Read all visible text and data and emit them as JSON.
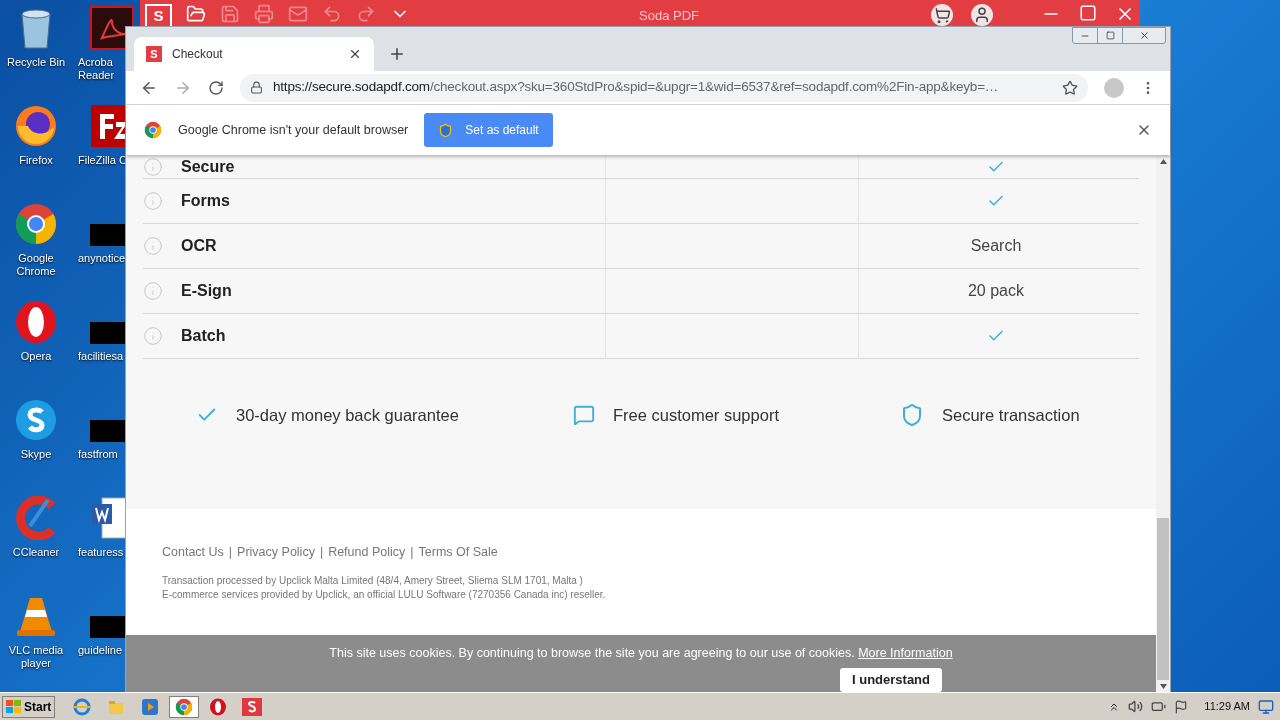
{
  "desktop": {
    "columns": [
      [
        {
          "kind": "recycle",
          "lines": [
            "Recycle Bin"
          ]
        },
        {
          "kind": "firefox",
          "lines": [
            "Firefox"
          ]
        },
        {
          "kind": "chrome",
          "lines": [
            "Google",
            "Chrome"
          ]
        },
        {
          "kind": "opera",
          "lines": [
            "Opera"
          ]
        },
        {
          "kind": "skype",
          "lines": [
            "Skype"
          ]
        },
        {
          "kind": "ccleaner",
          "lines": [
            "CCleaner"
          ]
        },
        {
          "kind": "vlc",
          "lines": [
            "VLC media",
            "player"
          ]
        }
      ],
      [
        {
          "kind": "acrobat",
          "lines": [
            "Acroba",
            "Reader"
          ]
        },
        {
          "kind": "filezilla",
          "lines": [
            "FileZilla C"
          ]
        },
        {
          "kind": "redacted",
          "lines": [
            "anynotice"
          ]
        },
        {
          "kind": "redacted",
          "lines": [
            "facilitiesa"
          ]
        },
        {
          "kind": "redacted",
          "lines": [
            "fastfrom"
          ]
        },
        {
          "kind": "word",
          "lines": [
            "featuress"
          ]
        },
        {
          "kind": "redacted",
          "lines": [
            "guideline"
          ]
        }
      ]
    ]
  },
  "soda_window": {
    "logo": "S",
    "title": "Soda PDF"
  },
  "browser": {
    "tabs": [
      {
        "title": "Checkout",
        "favicon": "S",
        "selected": true
      }
    ],
    "url_host": "https://secure.sodapdf.com",
    "url_path": "/checkout.aspx?sku=360StdPro&spid=&upgr=1&wid=6537&ref=sodapdf.com%2Fin-app&keyb=…",
    "infobar": {
      "message": "Google Chrome isn't your default browser",
      "button": "Set as default"
    }
  },
  "features": [
    {
      "name": "Secure",
      "kind": "check"
    },
    {
      "name": "Forms",
      "kind": "check"
    },
    {
      "name": "OCR",
      "kind": "text",
      "value": "Search"
    },
    {
      "name": "E-Sign",
      "kind": "text",
      "value": "20 pack"
    },
    {
      "name": "Batch",
      "kind": "check"
    }
  ],
  "guarantees": [
    {
      "kind": "check",
      "text": "30-day money back guarantee"
    },
    {
      "kind": "chat",
      "text": "Free customer support"
    },
    {
      "kind": "shield",
      "text": "Secure transaction"
    }
  ],
  "footer": {
    "links": [
      {
        "text": "Contact Us"
      },
      {
        "separator": "|",
        "text": "Privacy Policy"
      },
      {
        "separator": "|",
        "text": "Refund Policy"
      },
      {
        "separator": "|",
        "text": "Terms Of Sale"
      }
    ],
    "legal": [
      "Transaction processed by Upclick Malta Limited (48/4, Amery Street, Sliema SLM 1701, Malta )",
      "E-commerce services provided by Upclick, an official LULU Software (7270356 Canada inc) reseller."
    ]
  },
  "cookie_bar": {
    "text": "This site uses cookies. By continuing to browse the site you are agreeing to our use of cookies.",
    "link": "More Information",
    "button": "I understand"
  },
  "taskbar": {
    "start": "Start",
    "apps": [
      {
        "kind": "ie",
        "selected": false
      },
      {
        "kind": "explorer",
        "selected": false
      },
      {
        "kind": "media",
        "selected": false
      },
      {
        "kind": "chrome",
        "selected": true
      },
      {
        "kind": "opera",
        "selected": false
      },
      {
        "kind": "soda",
        "selected": false
      }
    ],
    "clock": "11:29 AM"
  }
}
